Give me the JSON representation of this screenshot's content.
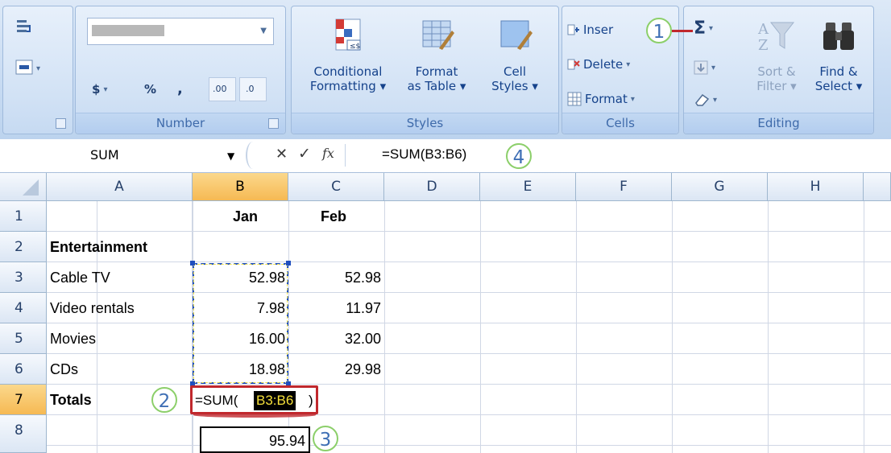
{
  "ribbon": {
    "number": {
      "format_value": "",
      "currency": "$",
      "percent": "%",
      "comma": ",",
      "inc_decimal": ".00",
      "dec_decimal": ".0",
      "label": "Number"
    },
    "styles": {
      "conditional": "Conditional\nFormatting ▾",
      "format_table": "Format\nas Table ▾",
      "cell_styles": "Cell\nStyles ▾",
      "label": "Styles"
    },
    "cells": {
      "insert": "Inser",
      "delete": "Delete",
      "format": "Format",
      "label": "Cells"
    },
    "editing": {
      "sum": "Σ",
      "sort_filter": "Sort &\nFilter ▾",
      "find_select": "Find &\nSelect ▾",
      "label": "Editing"
    }
  },
  "formula_bar": {
    "name_box": "SUM",
    "fx": "fx",
    "formula": "=SUM(B3:B6)"
  },
  "grid": {
    "columns": [
      "A",
      "B",
      "C",
      "D",
      "E",
      "F",
      "G",
      "H"
    ],
    "rows": [
      "1",
      "2",
      "3",
      "4",
      "5",
      "6",
      "7",
      "8"
    ],
    "cells": {
      "B1": "Jan",
      "C1": "Feb",
      "A2": "Entertainment",
      "A3": "Cable TV",
      "B3": "52.98",
      "C3": "52.98",
      "A4": "Video rentals",
      "B4": "7.98",
      "C4": "11.97",
      "A5": "Movies",
      "B5": "16.00",
      "C5": "32.00",
      "A6": "CDs",
      "B6": "18.98",
      "C6": "29.98",
      "A7": "Totals"
    },
    "edit_formula_prefix": "=SUM(",
    "edit_formula_range": "B3:B6",
    "edit_formula_suffix": ")",
    "result": "95.94"
  },
  "callouts": [
    "1",
    "2",
    "3",
    "4"
  ],
  "colors": {
    "callout_border": "#8ccf6a",
    "callout_text": "#3f6fb5",
    "highlight_red": "#c0282d",
    "header_selected": "#f6b953",
    "range_marquee": "#1f4fbf"
  }
}
